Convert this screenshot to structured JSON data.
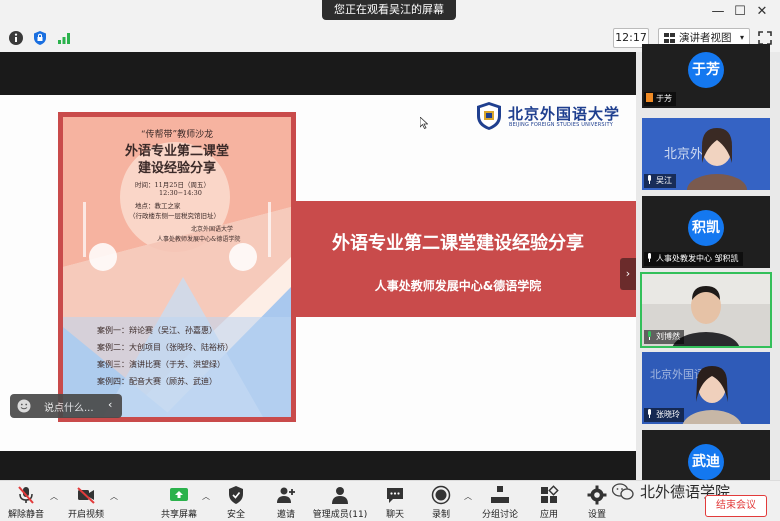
{
  "banner": {
    "text": "您正在观看吴江的屏幕"
  },
  "window_controls": {
    "minimize": "—",
    "maximize": "☐",
    "close": "✕"
  },
  "toolbar": {
    "time": "12:17",
    "view_label": "演讲者视图",
    "view_caret": "▾"
  },
  "slide": {
    "university_cn": "北京外国语大学",
    "university_en": "BEIJING FOREIGN STUDIES UNIVERSITY",
    "title": "外语专业第二课堂建设经验分享",
    "subtitle": "人事处教师发展中心&德语学院"
  },
  "poster": {
    "salon": "“传帮带”教师沙龙",
    "title_line1": "外语专业第二课堂",
    "title_line2": "建设经验分享",
    "time_line1": "时间：11月25日（周五）",
    "time_line2": "12:30−14:30",
    "place_line1": "地点：教工之家",
    "place_line2": "（行政楼东侧一层税究馆旧址）",
    "org_line1": "北京外国语大学",
    "org_line2": "人事处教师发展中心&德语学院",
    "cases": [
      "案例一：辩论赛（吴江、孙嘉惠）",
      "案例二：大创项目（张晓玲、陆裕桥）",
      "案例三：演讲比赛（于芳、洪望绿）",
      "案例四：配音大赛（顾苏、武迪）"
    ]
  },
  "collapse_arrow": "›",
  "chat": {
    "placeholder": "说点什么...",
    "arrow": "‹"
  },
  "participants": [
    {
      "name": "于芳",
      "initials": "于芳",
      "type": "avatar"
    },
    {
      "name": "吴江",
      "type": "video"
    },
    {
      "name": "人事处教发中心 邹积凯",
      "initials": "积凯",
      "type": "avatar"
    },
    {
      "name": "刘博然",
      "type": "video"
    },
    {
      "name": "张晓玲",
      "type": "video"
    },
    {
      "name": "",
      "initials": "武迪",
      "type": "avatar"
    }
  ],
  "bottom_toolbar": [
    {
      "label": "解除静音",
      "icon": "mic-muted-icon"
    },
    {
      "label": "开启视频",
      "icon": "video-off-icon"
    },
    {
      "label": "共享屏幕",
      "icon": "share-screen-icon"
    },
    {
      "label": "安全",
      "icon": "shield-icon"
    },
    {
      "label": "邀请",
      "icon": "invite-icon"
    },
    {
      "label": "管理成员(11)",
      "icon": "participants-icon"
    },
    {
      "label": "聊天",
      "icon": "chat-icon"
    },
    {
      "label": "录制",
      "icon": "record-icon"
    },
    {
      "label": "分组讨论",
      "icon": "breakout-icon"
    },
    {
      "label": "应用",
      "icon": "apps-icon"
    },
    {
      "label": "设置",
      "icon": "settings-icon"
    }
  ],
  "end_meeting": "结束会议",
  "watermark": "北外德语学院",
  "colors": {
    "accent_red": "#c94b4b",
    "zoom_blue": "#1478f0",
    "end_red": "#e23b3b",
    "active_green": "#33c05a"
  }
}
